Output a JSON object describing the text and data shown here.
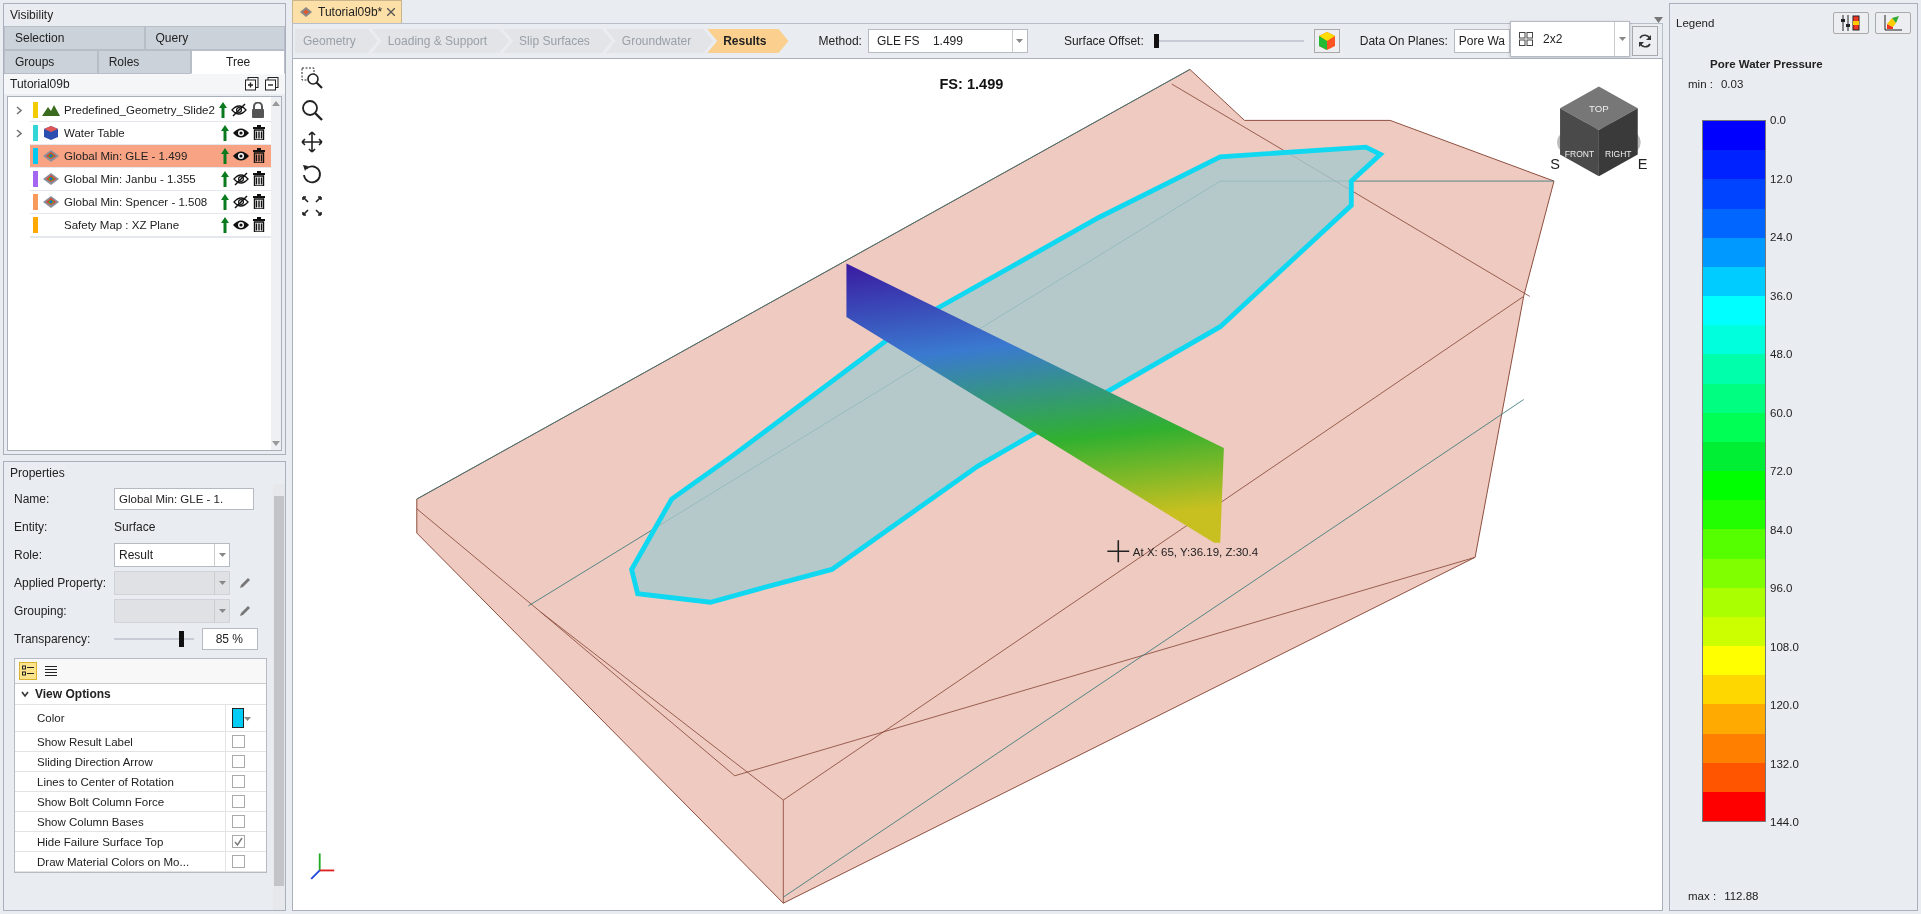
{
  "visibility_panel": {
    "title": "Visibility",
    "tab_rows": [
      [
        {
          "label": "Selection",
          "selected": false
        },
        {
          "label": "Query",
          "selected": false
        }
      ],
      [
        {
          "label": "Groups",
          "selected": false
        },
        {
          "label": "Roles",
          "selected": false
        },
        {
          "label": "Tree",
          "selected": true
        }
      ]
    ],
    "tree": {
      "root": "Tutorial09b",
      "items": [
        {
          "label": "Predefined_Geometry_Slide2",
          "kind": "geometry",
          "color": "#f2cc00",
          "expandable": true,
          "selected": false,
          "visible": false,
          "locked": true
        },
        {
          "label": "Water Table",
          "kind": "water",
          "color": "#33d6d6",
          "expandable": true,
          "selected": false,
          "visible": true,
          "locked": false
        },
        {
          "label": "Global Min: GLE  -  1.499",
          "kind": "surface",
          "color": "#00c8f0",
          "expandable": false,
          "selected": true,
          "visible": true,
          "locked": false
        },
        {
          "label": "Global Min: Janbu  -  1.355",
          "kind": "surface",
          "color": "#a466f0",
          "expandable": false,
          "selected": false,
          "visible": false,
          "locked": false
        },
        {
          "label": "Global Min: Spencer  -  1.508",
          "kind": "surface",
          "color": "#f79a5a",
          "expandable": false,
          "selected": false,
          "visible": false,
          "locked": false
        },
        {
          "label": "Safety Map : XZ Plane",
          "kind": "map",
          "color": "#ffa800",
          "expandable": false,
          "selected": false,
          "visible": true,
          "locked": false
        }
      ]
    }
  },
  "properties_panel": {
    "title": "Properties",
    "fields": [
      {
        "label": "Name:",
        "kind": "text",
        "value": "Global Min: GLE  -  1."
      },
      {
        "label": "Entity:",
        "kind": "static",
        "value": "Surface"
      },
      {
        "label": "Role:",
        "kind": "dropdown",
        "value": "Result",
        "disabled": false
      },
      {
        "label": "Applied Property:",
        "kind": "dropdown_edit",
        "disabled": true
      },
      {
        "label": "Grouping:",
        "kind": "dropdown_edit",
        "disabled": true
      }
    ],
    "transparency": {
      "label": "Transparency:",
      "level": 0.85,
      "value": "85 %"
    },
    "view_options": {
      "title": "View Options",
      "expanded": true,
      "rows": [
        {
          "label": "Color",
          "kind": "color",
          "color": "#00ccf5"
        },
        {
          "label": "Show Result Label",
          "kind": "checkbox",
          "checked": false
        },
        {
          "label": "Sliding Direction Arrow",
          "kind": "checkbox",
          "checked": false
        },
        {
          "label": "Lines to Center of Rotation",
          "kind": "checkbox",
          "checked": false
        },
        {
          "label": "Show Bolt Column Force",
          "kind": "checkbox",
          "checked": false
        },
        {
          "label": "Show Column Bases",
          "kind": "checkbox",
          "checked": false
        },
        {
          "label": "Hide Failure Surface Top",
          "kind": "checkbox",
          "checked": true
        },
        {
          "label": "Draw Material Colors on Mo...",
          "kind": "checkbox",
          "checked": false
        }
      ]
    }
  },
  "document_tab": {
    "title": "Tutorial09b*"
  },
  "workflow": [
    {
      "label": "Geometry",
      "selected": false
    },
    {
      "label": "Loading & Support",
      "selected": false
    },
    {
      "label": "Slip Surfaces",
      "selected": false
    },
    {
      "label": "Groundwater",
      "selected": false
    },
    {
      "label": "Results",
      "selected": true
    }
  ],
  "toolbar": {
    "method_label": "Method:",
    "method_value": "GLE FS    1.499",
    "offset_label": "Surface Offset:",
    "offset": {
      "level": 0
    },
    "planes_label": "Data On Planes:",
    "planes_value": "Pore Wa",
    "layout_value": "2x2"
  },
  "viewport": {
    "fs_label": "FS: 1.499",
    "cursor_readout": "At X: 65, Y:36.19, Z:30.4",
    "cube_faces": [
      "TOP",
      "FRONT",
      "RIGHT"
    ],
    "compass": [
      "S",
      "E"
    ]
  },
  "legend": {
    "title": "Legend",
    "heading": "Pore Water Pressure",
    "min_label": "min :",
    "min_value": "0.03",
    "max_label": "max :",
    "max_value": "112.88",
    "ticks": [
      "0.0",
      "12.0",
      "24.0",
      "36.0",
      "48.0",
      "60.0",
      "72.0",
      "84.0",
      "96.0",
      "108.0",
      "120.0",
      "132.0",
      "144.0"
    ],
    "bands": [
      {
        "color": "#0000ff"
      },
      {
        "color": "#0022ff"
      },
      {
        "color": "#0044ff"
      },
      {
        "color": "#0066ff"
      },
      {
        "color": "#0099ff"
      },
      {
        "color": "#00ccff"
      },
      {
        "color": "#00ffff"
      },
      {
        "color": "#00ffdd"
      },
      {
        "color": "#00ffaa"
      },
      {
        "color": "#00ff80"
      },
      {
        "color": "#00ff55"
      },
      {
        "color": "#00ee33"
      },
      {
        "color": "#00ff00"
      },
      {
        "color": "#22ff00"
      },
      {
        "color": "#55ff00"
      },
      {
        "color": "#80ff00"
      },
      {
        "color": "#aaff00"
      },
      {
        "color": "#ccff00"
      },
      {
        "color": "#ffff00"
      },
      {
        "color": "#ffd700"
      },
      {
        "color": "#ffaa00"
      },
      {
        "color": "#ff8000"
      },
      {
        "color": "#ff5500"
      },
      {
        "color": "#ff0000"
      }
    ]
  }
}
